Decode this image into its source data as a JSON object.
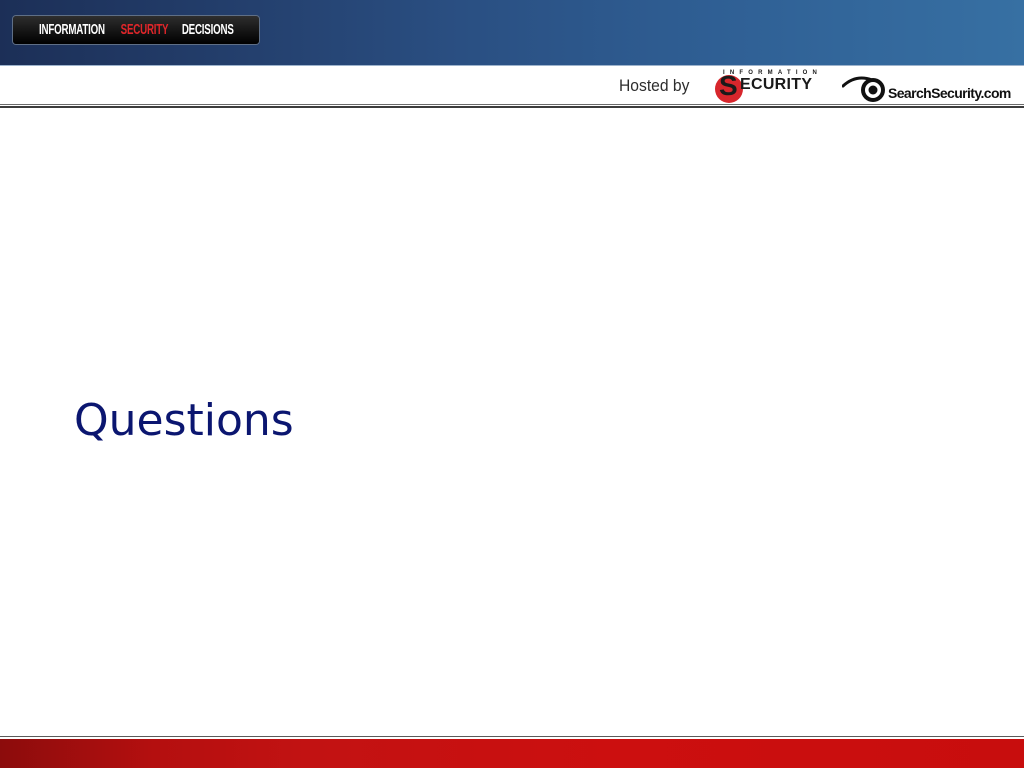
{
  "header": {
    "event_logo": {
      "part1": "INFORMATION",
      "part2": "SECURITY",
      "part3": "DECISIONS"
    },
    "hosted_by": "Hosted by",
    "infosec_logo": {
      "small_text": "INFORMATION",
      "s_letter": "S",
      "word": "ECURITY"
    },
    "searchsecurity_logo": "SearchSecurity.com"
  },
  "slide": {
    "title": "Questions"
  },
  "colors": {
    "banner_blue": "#2a4f82",
    "title_navy": "#0b1670",
    "footer_red": "#c21212",
    "logo_red": "#e0262a"
  }
}
